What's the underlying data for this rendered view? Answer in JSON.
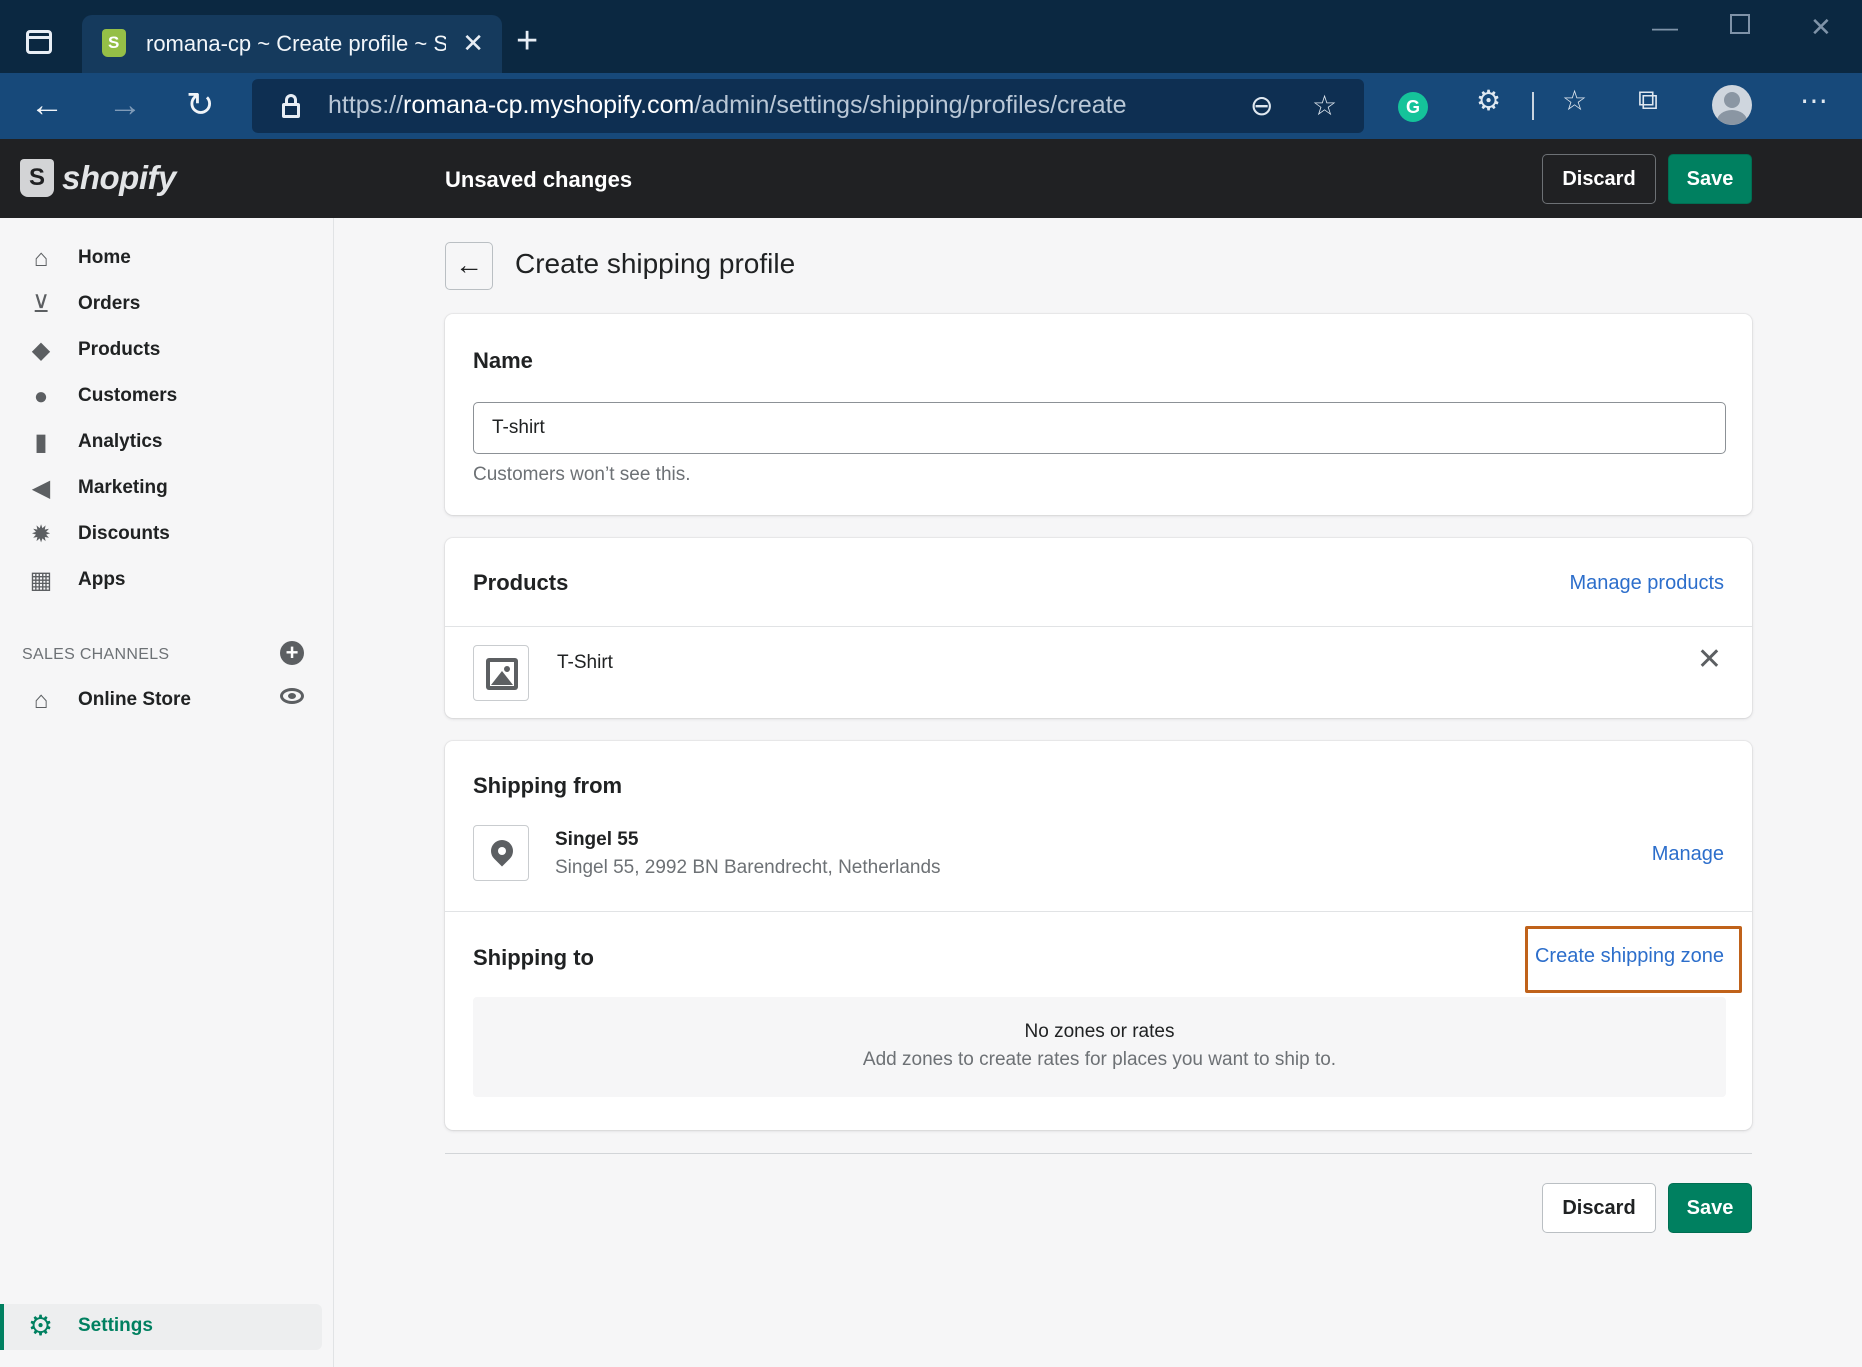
{
  "browser": {
    "tab_title": "romana-cp ~ Create profile ~ Sh",
    "url_prefix": "https://",
    "url_host": "romana-cp.myshopify.com",
    "url_path": "/admin/settings/shipping/profiles/create"
  },
  "topbar": {
    "logo_text": "shopify",
    "status": "Unsaved changes",
    "discard_label": "Discard",
    "save_label": "Save"
  },
  "sidebar": {
    "items": [
      {
        "label": "Home",
        "icon": "home-icon"
      },
      {
        "label": "Orders",
        "icon": "orders-icon"
      },
      {
        "label": "Products",
        "icon": "tag-icon"
      },
      {
        "label": "Customers",
        "icon": "person-icon"
      },
      {
        "label": "Analytics",
        "icon": "bar-chart-icon"
      },
      {
        "label": "Marketing",
        "icon": "megaphone-icon"
      },
      {
        "label": "Discounts",
        "icon": "discount-icon"
      },
      {
        "label": "Apps",
        "icon": "apps-icon"
      }
    ],
    "sales_channels_label": "SALES CHANNELS",
    "online_store_label": "Online Store",
    "settings_label": "Settings"
  },
  "page": {
    "title": "Create shipping profile"
  },
  "name_card": {
    "title": "Name",
    "value": "T-shirt",
    "help": "Customers won’t see this."
  },
  "products_card": {
    "title": "Products",
    "manage_label": "Manage products",
    "product_name": "T-Shirt"
  },
  "shipping_card": {
    "from_title": "Shipping from",
    "location_name": "Singel 55",
    "location_address": "Singel 55, 2992 BN Barendrecht, Netherlands",
    "manage_label": "Manage",
    "to_title": "Shipping to",
    "create_zone_label": "Create shipping zone",
    "empty_title": "No zones or rates",
    "empty_text": "Add zones to create rates for places you want to ship to."
  },
  "footer": {
    "discard_label": "Discard",
    "save_label": "Save"
  },
  "colors": {
    "primary": "#008060",
    "link": "#2c6ecb",
    "highlight": "#c0621a"
  }
}
